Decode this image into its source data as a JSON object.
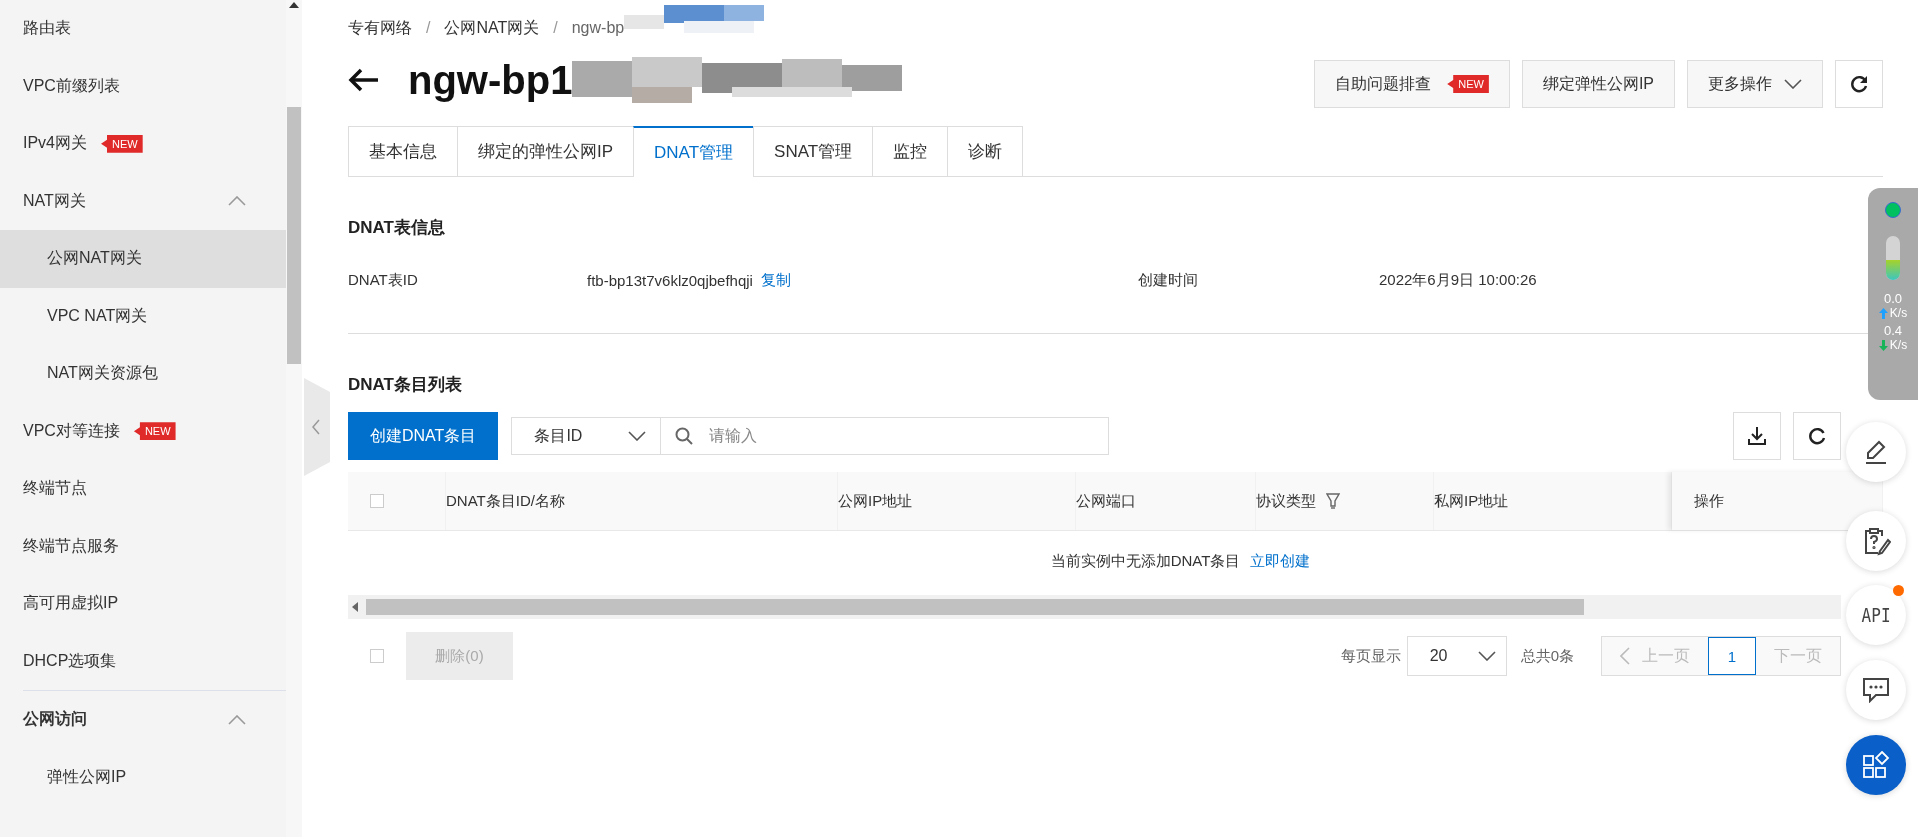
{
  "sidebar": {
    "items": [
      {
        "kind": "link",
        "label": "路由表",
        "selected": false
      },
      {
        "kind": "link",
        "label": "VPC前缀列表",
        "selected": false
      },
      {
        "kind": "link",
        "label": "IPv4网关",
        "badge": "NEW",
        "selected": false
      },
      {
        "kind": "folder",
        "label": "NAT网关",
        "expanded": true,
        "children": [
          {
            "kind": "link",
            "label": "公网NAT网关",
            "selected": true
          },
          {
            "kind": "link",
            "label": "VPC NAT网关",
            "selected": false
          },
          {
            "kind": "link",
            "label": "NAT网关资源包",
            "selected": false
          }
        ]
      },
      {
        "kind": "link",
        "label": "VPC对等连接",
        "badge": "NEW",
        "selected": false
      },
      {
        "kind": "link",
        "label": "终端节点",
        "selected": false
      },
      {
        "kind": "link",
        "label": "终端节点服务",
        "selected": false
      },
      {
        "kind": "link",
        "label": "高可用虚拟IP",
        "selected": false
      },
      {
        "kind": "link",
        "label": "DHCP选项集",
        "selected": false
      },
      {
        "kind": "section",
        "label": "公网访问",
        "expanded": true,
        "children": [
          {
            "kind": "link",
            "label": "弹性公网IP",
            "selected": false
          }
        ]
      }
    ]
  },
  "breadcrumb": [
    "专有网络",
    "公网NAT网关",
    "ngw-bp"
  ],
  "breadcrumb_separator": "/",
  "title": "ngw-bp1",
  "actions": [
    {
      "kind": "button",
      "label": "自助问题排查",
      "badge": "NEW"
    },
    {
      "kind": "button",
      "label": "绑定弹性公网IP"
    },
    {
      "kind": "dropdown",
      "label": "更多操作"
    }
  ],
  "tabs": [
    {
      "label": "基本信息",
      "selected": false
    },
    {
      "label": "绑定的弹性公网IP",
      "selected": false
    },
    {
      "label": "DNAT管理",
      "selected": true
    },
    {
      "label": "SNAT管理",
      "selected": false
    },
    {
      "label": "监控",
      "selected": false
    },
    {
      "label": "诊断",
      "selected": false
    }
  ],
  "info": {
    "title": "DNAT表信息",
    "fields": [
      {
        "label": "DNAT表ID",
        "value": "ftb-bp13t7v6klz0qjbefhqji",
        "link": "复制"
      },
      {
        "label": "创建时间",
        "value": "2022年6月9日 10:00:26"
      }
    ]
  },
  "list": {
    "title": "DNAT条目列表",
    "create_button": "创建DNAT条目",
    "filter_select": "条目ID",
    "search": {
      "placeholder": "请输入"
    },
    "header_checkbox": {
      "checked": false
    },
    "columns": [
      {
        "label": "DNAT条目ID/名称",
        "filter": false
      },
      {
        "label": "公网IP地址",
        "filter": false
      },
      {
        "label": "公网端口",
        "filter": false
      },
      {
        "label": "协议类型",
        "filter": true
      },
      {
        "label": "私网IP地址",
        "filter": false
      },
      {
        "label": "操作",
        "filter": false
      }
    ],
    "empty_text": "当前实例中无添加DNAT条目",
    "empty_link": "立即创建",
    "footer": {
      "select_all": {
        "checked": false
      },
      "delete_button": {
        "label": "删除(0)",
        "disabled": true
      },
      "page_size_label": "每页显示",
      "page_size": "20",
      "total": "总共0条",
      "prev": {
        "label": "上一页",
        "disabled": true
      },
      "pages": [
        {
          "label": "1",
          "selected": true
        }
      ],
      "next": {
        "label": "下一页",
        "disabled": true
      }
    }
  },
  "monitor": {
    "level": 0.45,
    "upload": "0.0",
    "upload_unit": "K/s",
    "download": "0.4",
    "download_unit": "K/s"
  },
  "float_buttons": [
    {
      "kind": "edit",
      "notification": false
    },
    {
      "kind": "help",
      "notification": false
    },
    {
      "kind": "api",
      "label": "API",
      "notification": true
    },
    {
      "kind": "chat",
      "notification": false
    },
    {
      "kind": "apps",
      "notification": false
    }
  ]
}
